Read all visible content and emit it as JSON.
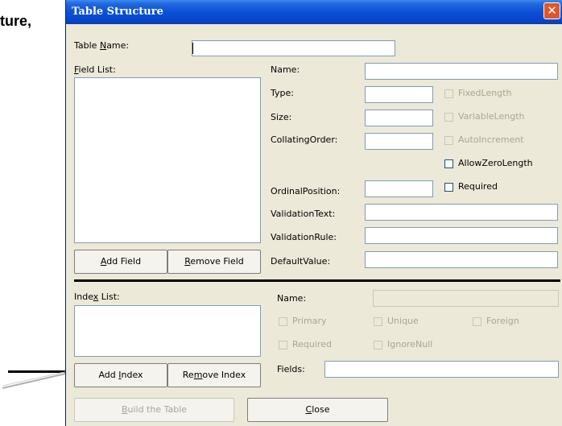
{
  "outside_text": "ture,",
  "window": {
    "title": "Table Structure",
    "close_glyph": "✕"
  },
  "table_name": {
    "label_pre": "Table ",
    "label_accel": "N",
    "label_post": "ame:",
    "value": ""
  },
  "field_list": {
    "label_accel": "F",
    "label_post": "ield List:",
    "items": []
  },
  "field_props": {
    "name_label": "Name:",
    "type_label": "Type:",
    "size_label": "Size:",
    "collating_label": "CollatingOrder:",
    "ordinal_label": "OrdinalPosition:",
    "validation_text_label": "ValidationText:",
    "validation_rule_label": "ValidationRule:",
    "default_value_label": "DefaultValue:"
  },
  "field_checks": {
    "fixed_length": "FixedLength",
    "variable_length": "VariableLength",
    "auto_increment": "AutoIncrement",
    "allow_zero_length": "AllowZeroLength",
    "required": "Required"
  },
  "field_buttons": {
    "add_accel": "A",
    "add_post": "dd Field",
    "remove_accel": "R",
    "remove_post": "emove Field"
  },
  "index_list": {
    "label_pre": "Inde",
    "label_accel": "x",
    "label_post": " List:",
    "items": []
  },
  "index_props": {
    "name_label": "Name:",
    "primary": "Primary",
    "unique": "Unique",
    "foreign": "Foreign",
    "required": "Required",
    "ignore_null": "IgnoreNull",
    "fields_label": "Fields:"
  },
  "index_buttons": {
    "add_pre": "Add ",
    "add_accel": "I",
    "add_post": "ndex",
    "remove_pre": "Re",
    "remove_accel": "m",
    "remove_post": "ove Index"
  },
  "bottom_buttons": {
    "build_accel": "B",
    "build_post": "uild the Table",
    "close_accel": "C",
    "close_post": "lose"
  }
}
